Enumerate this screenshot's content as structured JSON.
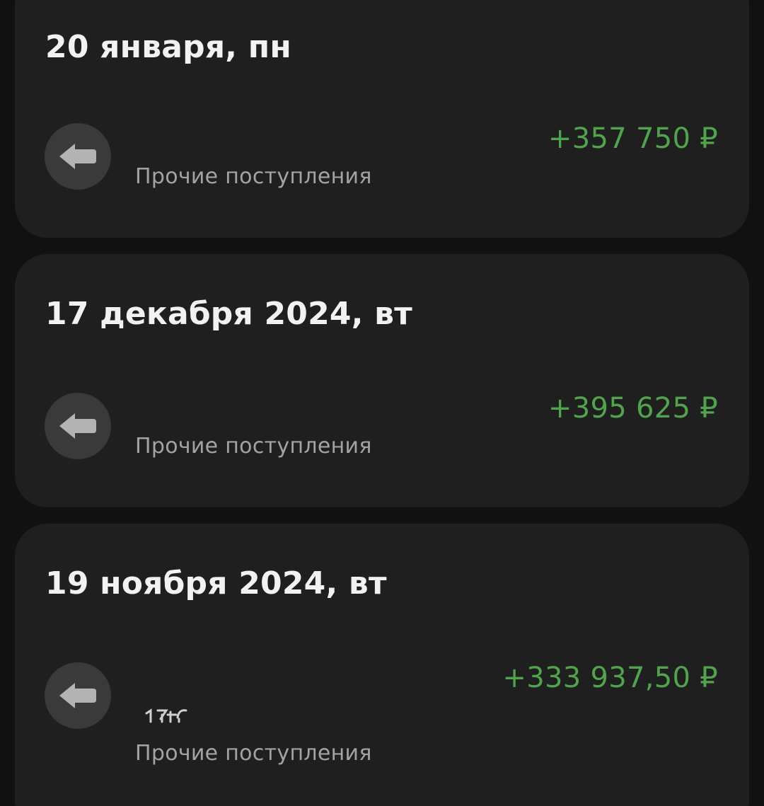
{
  "operations": [
    {
      "date": "20 января, пн",
      "amount": "+357 750 ₽",
      "category": "Прочие поступления",
      "icon": "arrow-left-icon"
    },
    {
      "date": "17 декабря 2024, вт",
      "amount": "+395 625 ₽",
      "category": "Прочие поступления",
      "icon": "arrow-left-icon"
    },
    {
      "date": "19 ноября 2024, вт",
      "amount": "+333 937,50 ₽",
      "category": "Прочие поступления",
      "icon": "arrow-left-icon"
    }
  ],
  "colors": {
    "background": "#111111",
    "card": "#1f1f1f",
    "icon_circle": "#3a3a3a",
    "icon_arrow": "#b3b3b3",
    "amount_positive": "#4fa64a",
    "date_text": "#f2f2f2",
    "category_text": "#a3a3a3"
  }
}
